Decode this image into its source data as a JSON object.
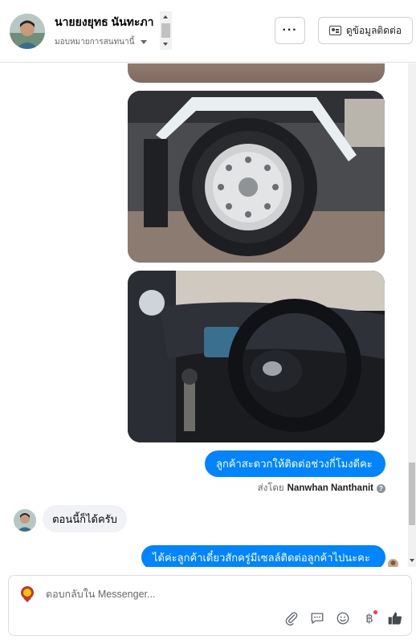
{
  "header": {
    "name": "นายยงยุทธ นันทะภา",
    "assign_label": "มอบหมายการสนทนานี้",
    "more_label": "···",
    "contact_label": "ดูข้อมูลติดต่อ"
  },
  "conversation": {
    "messages": [
      {
        "type": "image",
        "description_icon": "image-icon"
      },
      {
        "type": "image",
        "description_icon": "image-icon"
      },
      {
        "type": "image",
        "description_icon": "image-icon"
      },
      {
        "type": "text",
        "direction": "outgoing",
        "text": "ลูกค้าสะดวกให้ติดต่อช่วงกี่โมงดีคะ"
      },
      {
        "type": "meta",
        "sent_by_label": "ส่งโดย",
        "sent_by_name": "Nanwhan Nanthanit"
      },
      {
        "type": "text",
        "direction": "incoming",
        "text": "ตอนนี้ก็ได้ครับ"
      },
      {
        "type": "text",
        "direction": "outgoing",
        "text": "ได้ค่ะลูกค้าเดี๋ยวสักครู่มีเซลล์ติดต่อลูกค้าไปนะคะ"
      }
    ]
  },
  "composer": {
    "placeholder": "ตอบกลับใน Messenger...",
    "value": ""
  },
  "colors": {
    "accent": "#0084ff",
    "incoming_bubble": "#f0f2f5",
    "icon": "#606770"
  }
}
